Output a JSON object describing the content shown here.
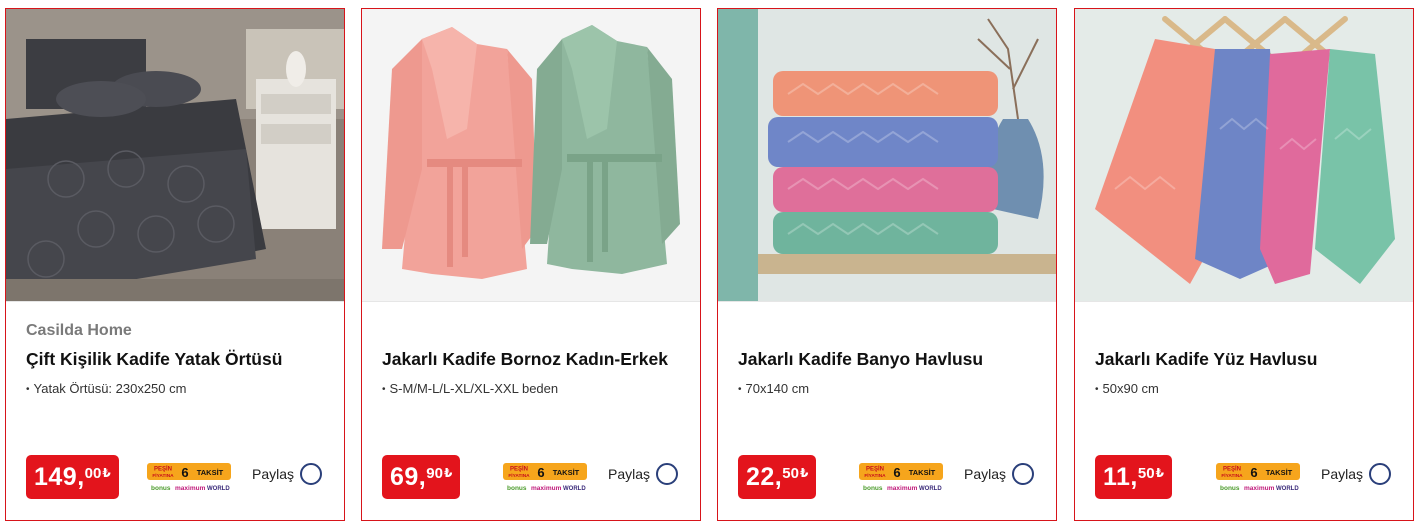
{
  "products": [
    {
      "brand": "Casilda Home",
      "title": "Çift Kişilik Kadife Yatak Örtüsü",
      "spec": "Yatak Örtüsü: 230x250 cm",
      "price_int": "149,",
      "price_frac": "00",
      "currency": "₺",
      "share_label": "Paylaş",
      "image_icon": "bedspread-image"
    },
    {
      "brand": "",
      "title": "Jakarlı Kadife Bornoz Kadın-Erkek",
      "spec": "S-M/M-L/L-XL/XL-XXL beden",
      "price_int": "69,",
      "price_frac": "90",
      "currency": "₺",
      "share_label": "Paylaş",
      "image_icon": "bathrobe-image"
    },
    {
      "brand": "",
      "title": "Jakarlı Kadife Banyo Havlusu",
      "spec": "70x140 cm",
      "price_int": "22,",
      "price_frac": "50",
      "currency": "₺",
      "share_label": "Paylaş",
      "image_icon": "bath-towels-image"
    },
    {
      "brand": "",
      "title": "Jakarlı Kadife Yüz Havlusu",
      "spec": "50x90 cm",
      "price_int": "11,",
      "price_frac": "50",
      "currency": "₺",
      "share_label": "Paylaş",
      "image_icon": "face-towels-image"
    }
  ],
  "taksit_badge": {
    "line1": "PEŞİN",
    "line2": "FİYATINA",
    "count": "6",
    "word": "TAKSİT",
    "bonus": "bonus",
    "maximum": "maximum",
    "world": "WORLD"
  },
  "colors": {
    "accent": "#e3141c",
    "card_border": "#d7141a",
    "share_circle": "#2a3f7a",
    "badge_orange": "#f6a51c"
  }
}
